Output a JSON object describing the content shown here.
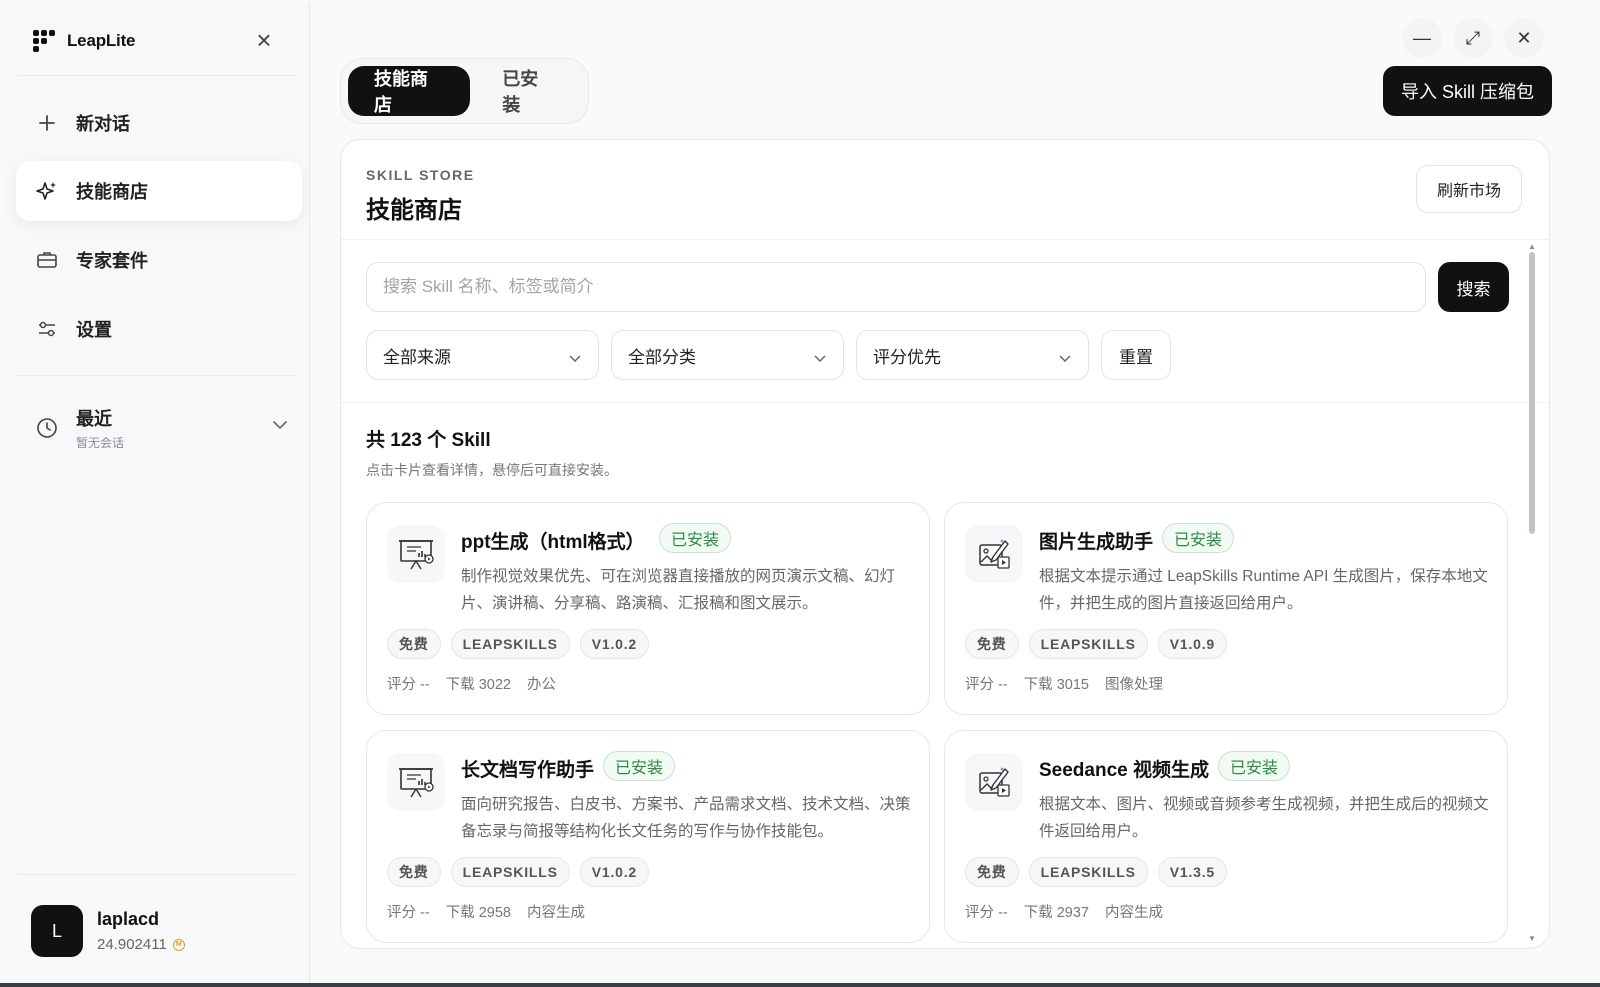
{
  "app": {
    "name": "LeapLite"
  },
  "sidebar": {
    "items": [
      {
        "label": "新对话",
        "icon": "plus-icon"
      },
      {
        "label": "技能商店",
        "icon": "sparkle-icon"
      },
      {
        "label": "专家套件",
        "icon": "briefcase-icon"
      },
      {
        "label": "设置",
        "icon": "sliders-icon"
      }
    ],
    "recent": {
      "title": "最近",
      "subtitle": "暂无会话"
    },
    "user": {
      "initial": "L",
      "name": "laplacd",
      "balance": "24.902411",
      "coin_symbol": "M"
    }
  },
  "window_controls": {
    "minimize": "—",
    "maximize": "⤢",
    "close": "✕"
  },
  "tabs": [
    "技能商店",
    "已安装"
  ],
  "import_button": "导入 Skill 压缩包",
  "store": {
    "kicker": "SKILL STORE",
    "title": "技能商店",
    "refresh": "刷新市场",
    "search_placeholder": "搜索 Skill 名称、标签或简介",
    "search_button": "搜索",
    "filters": [
      "全部来源",
      "全部分类",
      "评分优先"
    ],
    "reset": "重置",
    "count": "共 123 个 Skill",
    "hint": "点击卡片查看详情，悬停后可直接安装。"
  },
  "skills": [
    {
      "title": "ppt生成（html格式）",
      "installed": "已安装",
      "desc": "制作视觉效果优先、可在浏览器直接播放的网页演示文稿、幻灯片、演讲稿、分享稿、路演稿、汇报稿和图文展示。",
      "tags": [
        "免费",
        "LEAPSKILLS",
        "V1.0.2"
      ],
      "rating": "评分 --",
      "downloads": "下载 3022",
      "category": "办公",
      "icon": "presentation-icon"
    },
    {
      "title": "图片生成助手",
      "installed": "已安装",
      "desc": "根据文本提示通过 LeapSkills Runtime API 生成图片，保存本地文件，并把生成的图片直接返回给用户。",
      "tags": [
        "免费",
        "LEAPSKILLS",
        "V1.0.9"
      ],
      "rating": "评分 --",
      "downloads": "下载 3015",
      "category": "图像处理",
      "icon": "image-magic-icon"
    },
    {
      "title": "长文档写作助手",
      "installed": "已安装",
      "desc": "面向研究报告、白皮书、方案书、产品需求文档、技术文档、决策备忘录与简报等结构化长文任务的写作与协作技能包。",
      "tags": [
        "免费",
        "LEAPSKILLS",
        "V1.0.2"
      ],
      "rating": "评分 --",
      "downloads": "下载 2958",
      "category": "内容生成",
      "icon": "presentation-icon"
    },
    {
      "title": "Seedance 视频生成",
      "installed": "已安装",
      "desc": "根据文本、图片、视频或音频参考生成视频，并把生成后的视频文件返回给用户。",
      "tags": [
        "免费",
        "LEAPSKILLS",
        "V1.3.5"
      ],
      "rating": "评分 --",
      "downloads": "下载 2937",
      "category": "内容生成",
      "icon": "image-magic-icon"
    }
  ]
}
